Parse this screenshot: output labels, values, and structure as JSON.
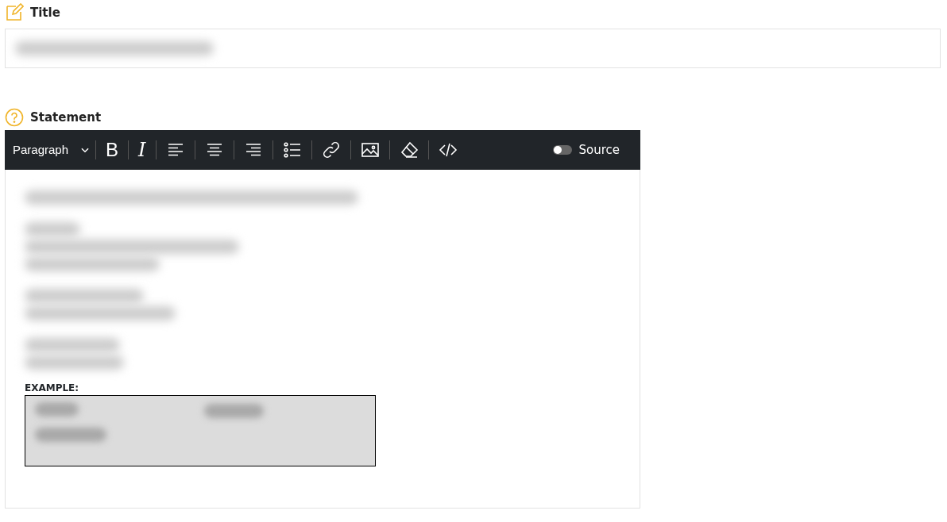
{
  "title_section": {
    "label": "Title",
    "field": {
      "blurred": true
    }
  },
  "statement_section": {
    "label": "Statement",
    "toolbar": {
      "format_select": "Paragraph",
      "tools": [
        {
          "kind": "text",
          "label": "B"
        },
        {
          "kind": "text-italic",
          "label": "I"
        },
        {
          "kind": "align-left"
        },
        {
          "kind": "align-center"
        },
        {
          "kind": "align-right"
        },
        {
          "kind": "list"
        },
        {
          "kind": "link"
        },
        {
          "kind": "image"
        },
        {
          "kind": "eraser"
        },
        {
          "kind": "code"
        }
      ],
      "source_toggle": {
        "label": "Source",
        "on": false
      }
    },
    "blocks": [
      {
        "kind": "blurred-paragraph"
      },
      {
        "kind": "blurred-paragraph"
      },
      {
        "kind": "blurred-paragraph"
      },
      {
        "kind": "blurred-paragraph"
      },
      {
        "kind": "example-label",
        "text": "EXAMPLE:"
      },
      {
        "kind": "example-box"
      }
    ]
  }
}
